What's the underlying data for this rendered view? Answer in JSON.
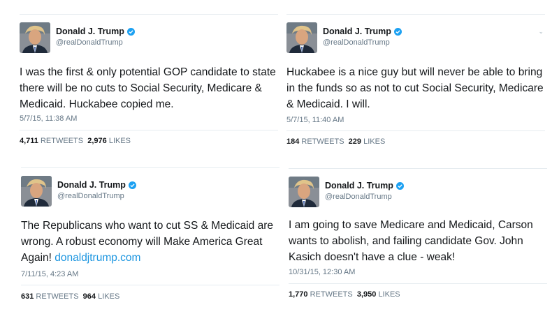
{
  "author": {
    "name": "Donald J. Trump",
    "handle": "@realDonaldTrump"
  },
  "colors": {
    "link": "#1b95e0",
    "verified": "#1da1f2",
    "meta": "#657786"
  },
  "tweets": [
    {
      "text": "I was the first & only potential GOP candidate to state there will be no cuts to Social Security, Medicare & Medicaid. Huckabee copied me.",
      "timestamp": "5/7/15, 11:38 AM",
      "retweets": "4,711",
      "retweets_label": "RETWEETS",
      "likes": "2,976",
      "likes_label": "LIKES"
    },
    {
      "text": "Huckabee is a nice guy but will never be able to bring in the funds so as not to cut Social Security, Medicare & Medicaid. I will.",
      "timestamp": "5/7/15, 11:40 AM",
      "retweets": "184",
      "retweets_label": "RETWEETS",
      "likes": "229",
      "likes_label": "LIKES"
    },
    {
      "text": "The Republicans who want to cut SS & Medicaid are wrong. A robust economy will Make America Great Again!",
      "link": "donaldjtrump.com",
      "timestamp": "7/11/15, 4:23 AM",
      "retweets": "631",
      "retweets_label": "RETWEETS",
      "likes": "964",
      "likes_label": "LIKES"
    },
    {
      "text": "I am going to save Medicare and Medicaid, Carson wants to abolish, and failing candidate Gov. John Kasich doesn't have a clue - weak!",
      "timestamp": "10/31/15, 12:30 AM",
      "retweets": "1,770",
      "retweets_label": "RETWEETS",
      "likes": "3,950",
      "likes_label": "LIKES"
    }
  ]
}
